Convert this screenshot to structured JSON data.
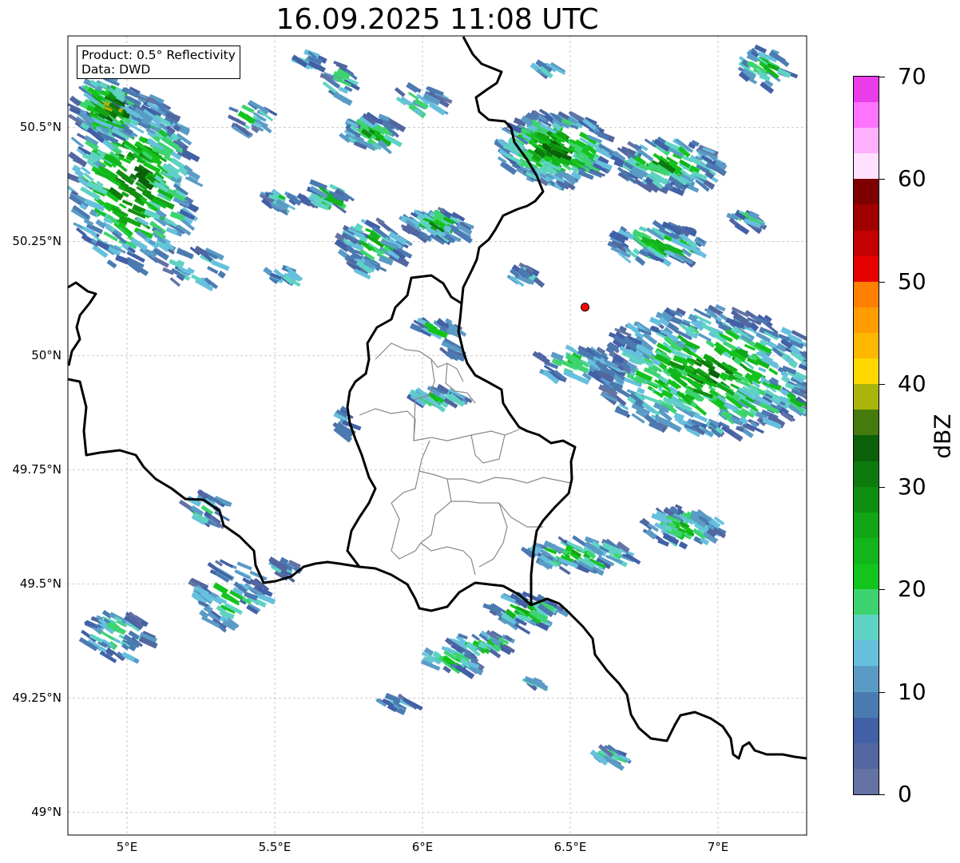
{
  "title": "16.09.2025 11:08 UTC",
  "info": {
    "product": "Product: 0.5° Reflectivity",
    "source": "Data: DWD"
  },
  "map": {
    "lon_range": [
      4.8,
      7.3
    ],
    "lat_range": [
      48.95,
      50.7
    ],
    "lat_ticks": [
      {
        "v": 50.5,
        "label": "50.5°N"
      },
      {
        "v": 50.25,
        "label": "50.25°N"
      },
      {
        "v": 50.0,
        "label": "50°N"
      },
      {
        "v": 49.75,
        "label": "49.75°N"
      },
      {
        "v": 49.5,
        "label": "49.5°N"
      },
      {
        "v": 49.25,
        "label": "49.25°N"
      },
      {
        "v": 49.0,
        "label": "49°N"
      }
    ],
    "lon_ticks": [
      {
        "v": 5.0,
        "label": "5°E"
      },
      {
        "v": 5.5,
        "label": "5.5°E"
      },
      {
        "v": 6.0,
        "label": "6°E"
      },
      {
        "v": 6.5,
        "label": "6.5°E"
      },
      {
        "v": 7.0,
        "label": "7°E"
      }
    ],
    "grid": true,
    "marker": {
      "lon": 6.55,
      "lat": 50.106,
      "color": "#ff0000"
    }
  },
  "colorbar": {
    "unit": "dBZ",
    "min": 0,
    "max": 70,
    "ticks": [
      {
        "v": 0,
        "label": "0"
      },
      {
        "v": 10,
        "label": "10"
      },
      {
        "v": 20,
        "label": "20"
      },
      {
        "v": 30,
        "label": "30"
      },
      {
        "v": 40,
        "label": "40"
      },
      {
        "v": 50,
        "label": "50"
      },
      {
        "v": 60,
        "label": "60"
      },
      {
        "v": 70,
        "label": "70"
      }
    ],
    "colors": [
      "#6473a3",
      "#5266a0",
      "#4260a6",
      "#4b7ab1",
      "#5a9bc6",
      "#66c0dd",
      "#5fd3c3",
      "#3dd46f",
      "#13c41d",
      "#12b51b",
      "#12a514",
      "#0f8f0f",
      "#0d7a0d",
      "#0a610a",
      "#457a0d",
      "#aab40b",
      "#ffd800",
      "#ffb800",
      "#ff9d00",
      "#ff7f00",
      "#e50000",
      "#c50000",
      "#a10000",
      "#7e0000",
      "#ffe0ff",
      "#ffb0ff",
      "#ff73ff",
      "#e93de9"
    ]
  }
}
